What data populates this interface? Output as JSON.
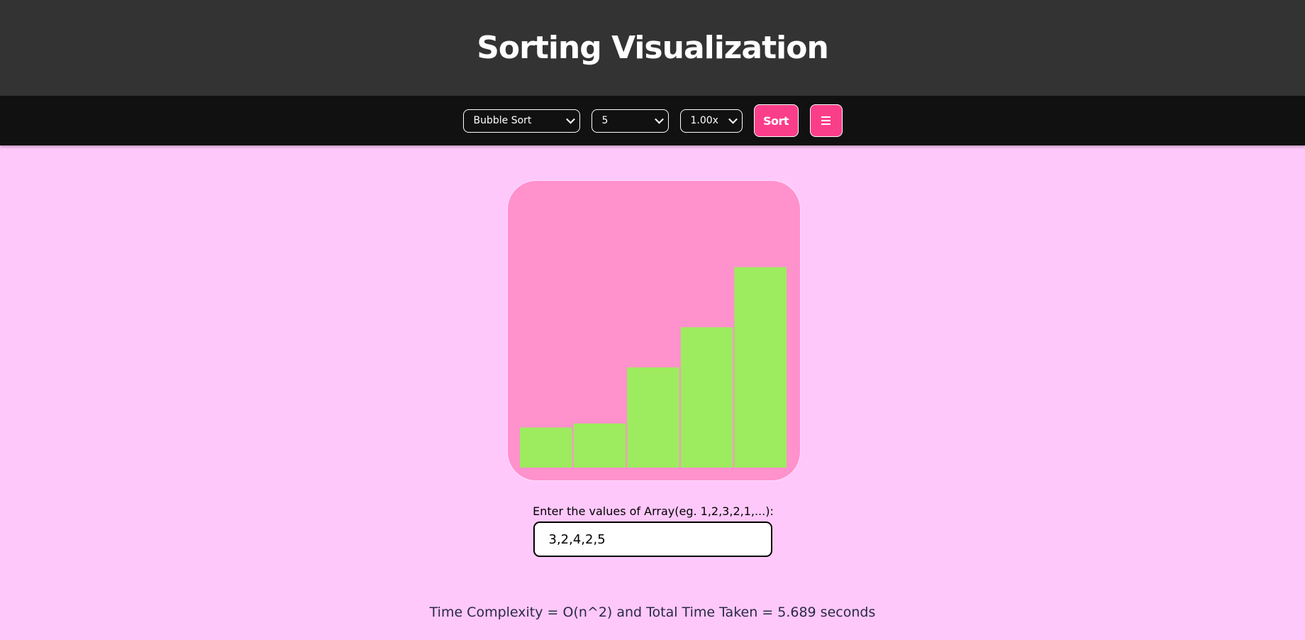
{
  "header": {
    "title": "Sorting Visualization"
  },
  "toolbar": {
    "algorithm": {
      "selected": "Bubble Sort"
    },
    "size": {
      "selected": "5"
    },
    "speed": {
      "selected": "1.00x"
    },
    "sort_label": "Sort",
    "menu_icon": "hamburger-menu-icon"
  },
  "colors": {
    "header_bg": "#333333",
    "toolbar_bg": "#111111",
    "page_bg": "#ffc8fb",
    "viz_bg": "#ff91cd",
    "bar": "#9deb5f",
    "button": "#fb3e8a"
  },
  "input": {
    "label": "Enter the values of Array(eg. 1,2,3,2,1,...):",
    "value": "3,2,4,2,5"
  },
  "result": {
    "text": "Time Complexity = O(n^2) and Total Time Taken = 5.689 seconds"
  },
  "chart_data": {
    "type": "bar",
    "values": [
      1,
      1.1,
      2.5,
      3.5,
      5
    ],
    "bar_color": "#9deb5f",
    "ylim": [
      0,
      7.15
    ],
    "grid": false
  }
}
